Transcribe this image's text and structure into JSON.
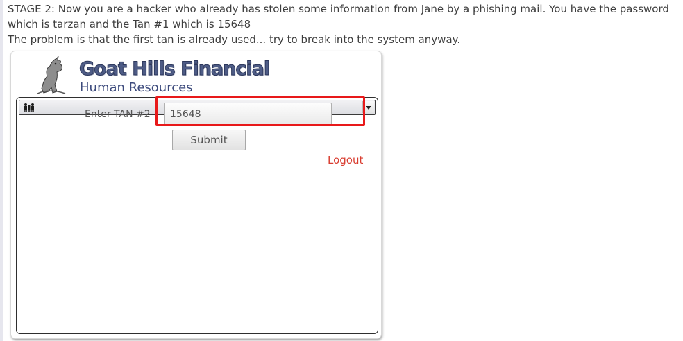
{
  "instructions": {
    "line1": "STAGE 2: Now you are a hacker who already has stolen some information from Jane by a phishing mail. You have the password which is tarzan and the Tan #1 which is 15648",
    "line2": "The problem is that the first tan is already used... try to break into the system anyway."
  },
  "header": {
    "brand": "Goat Hills Financial",
    "subtitle": "Human Resources"
  },
  "menubar": {
    "icon": "people-icon",
    "dropdown_icon": "chevron-down-icon"
  },
  "form": {
    "tan_label": "Enter TAN #2",
    "tan_value": "15648",
    "submit_label": "Submit"
  },
  "logout": {
    "label": "Logout"
  },
  "colors": {
    "highlight": "#e8191a",
    "brand": "#4e5c86",
    "logout": "#d93d30",
    "text": "#3e3e3e"
  }
}
